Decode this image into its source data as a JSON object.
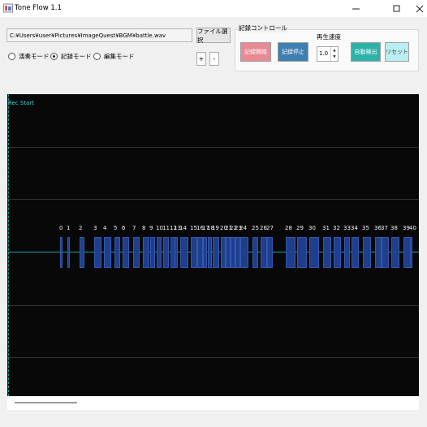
{
  "window": {
    "title": "Tone Flow 1.1",
    "controls": [
      "minimize-icon",
      "maximize-icon",
      "close-icon"
    ]
  },
  "file": {
    "path": "C:¥Users¥user¥Pictures¥ImageQuest¥BGM¥battle.wav",
    "select_label": "ファイル選択"
  },
  "modes": [
    {
      "label": "演奏モード",
      "selected": false
    },
    {
      "label": "記録モード",
      "selected": true
    },
    {
      "label": "編集モード",
      "selected": false
    }
  ],
  "zoom": {
    "plus_label": "+",
    "minus_label": "-"
  },
  "record_control": {
    "title": "記録コントロール",
    "start_label": "記録開始",
    "stop_label": "記録停止",
    "speed_label": "再生速度",
    "speed_value": "1.0",
    "auto_detect_label": "自動検出",
    "reset_label": "リセット"
  },
  "canvas": {
    "rec_start_label": "Rec Start",
    "notes": [
      "0",
      "1",
      "2",
      "3",
      "4",
      "5",
      "6",
      "7",
      "8",
      "9",
      "10",
      "11",
      "12",
      "13",
      "14",
      "15",
      "16",
      "17",
      "18",
      "19",
      "20",
      "21",
      "22",
      "23",
      "24",
      "25",
      "26",
      "27",
      "28",
      "29",
      "30",
      "31",
      "32",
      "33",
      "34",
      "35",
      "36",
      "37",
      "38",
      "39",
      "40"
    ]
  },
  "colors": {
    "start_btn": "#e88a93",
    "stop_btn": "#3e7fb2",
    "auto_btn": "#2bb3a8",
    "reset_btn": "#b9eef2",
    "canvas_bg": "#080808",
    "note_fill": "#1f3f8a",
    "accent": "#33d6d6"
  }
}
